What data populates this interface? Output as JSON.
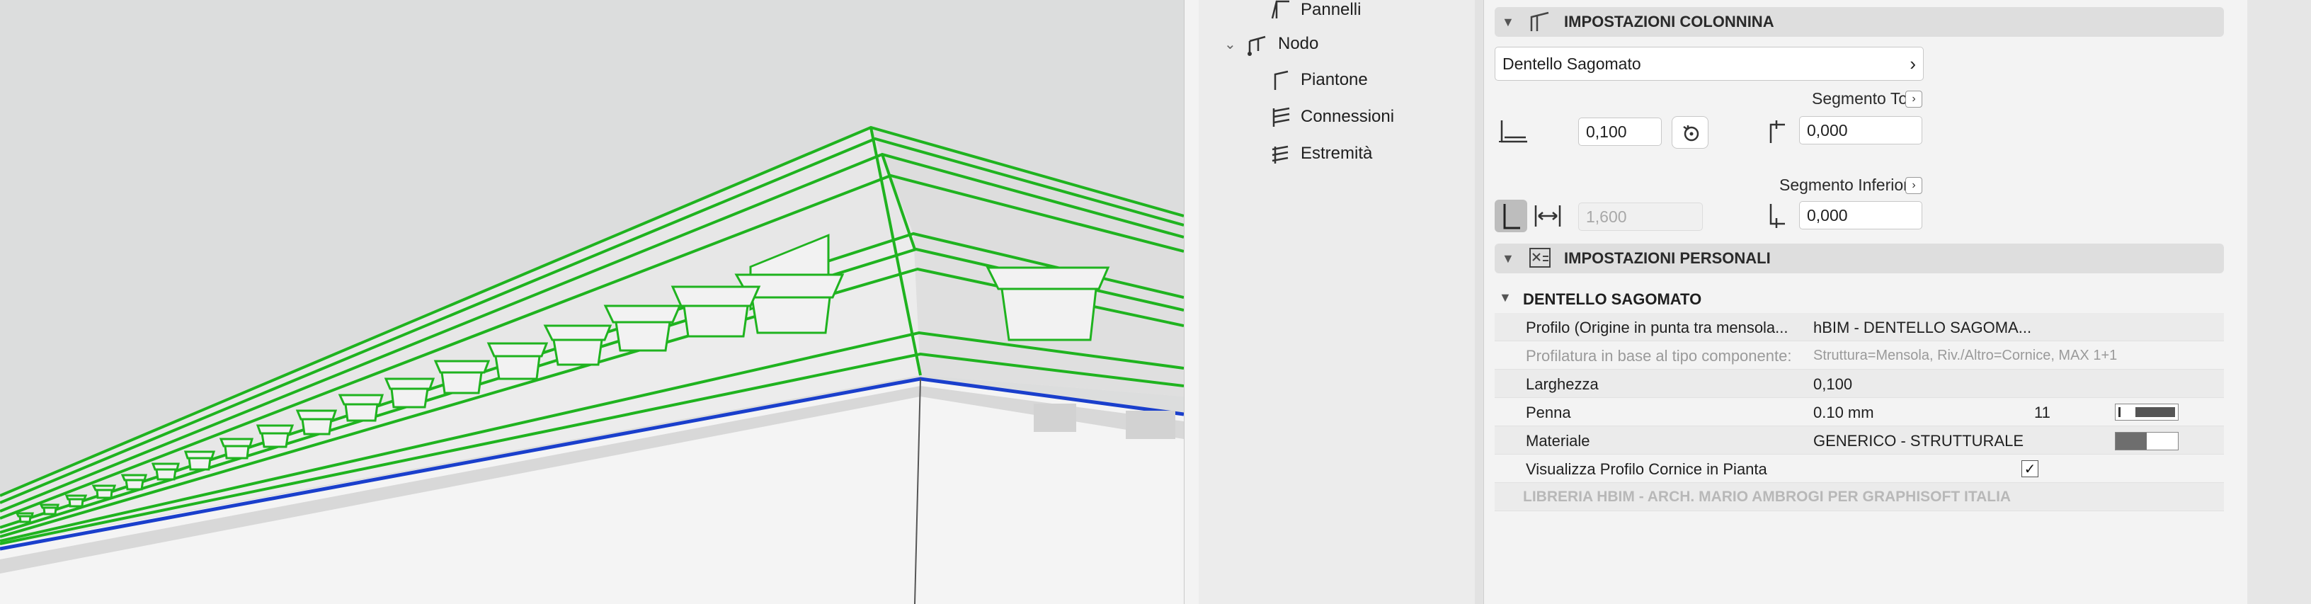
{
  "tree": {
    "items": [
      {
        "label": "Pannelli"
      },
      {
        "label": "Nodo"
      },
      {
        "label": "Piantone"
      },
      {
        "label": "Connessioni"
      },
      {
        "label": "Estremità"
      }
    ]
  },
  "column_settings": {
    "header": "IMPOSTAZIONI COLONNINA",
    "type_selector": "Dentello Sagomato",
    "width_value": "0,100",
    "segment_top_label": "Segmento Top",
    "segment_top_value": "0,000",
    "segment_bottom_label": "Segmento Inferiore",
    "segment_bottom_value": "0,000",
    "height_value": "1,600"
  },
  "custom_settings": {
    "header": "IMPOSTAZIONI PERSONALI",
    "group_title": "DENTELLO SAGOMATO",
    "rows": [
      {
        "key": "Profilo (Origine in punta tra mensola...",
        "value": "hBIM - DENTELLO SAGOMA..."
      },
      {
        "key": "Profilatura in base al tipo componente:",
        "value": "Struttura=Mensola, Riv./Altro=Cornice, MAX 1+1"
      },
      {
        "key": "Larghezza",
        "value": "0,100"
      },
      {
        "key": "Penna",
        "value": "0.10 mm",
        "extra": "11"
      },
      {
        "key": "Materiale",
        "value": "GENERICO - STRUTTURALE"
      },
      {
        "key": "Visualizza Profilo Cornice in Pianta",
        "value": ""
      }
    ],
    "footer": "LIBRERIA HBIM - ARCH. MARIO AMBROGI PER GRAPHISOFT ITALIA"
  },
  "colors": {
    "selection_green": "#1fb31f",
    "edge_blue": "#1a3fcc",
    "viewport_bg": "#dcdddd"
  }
}
